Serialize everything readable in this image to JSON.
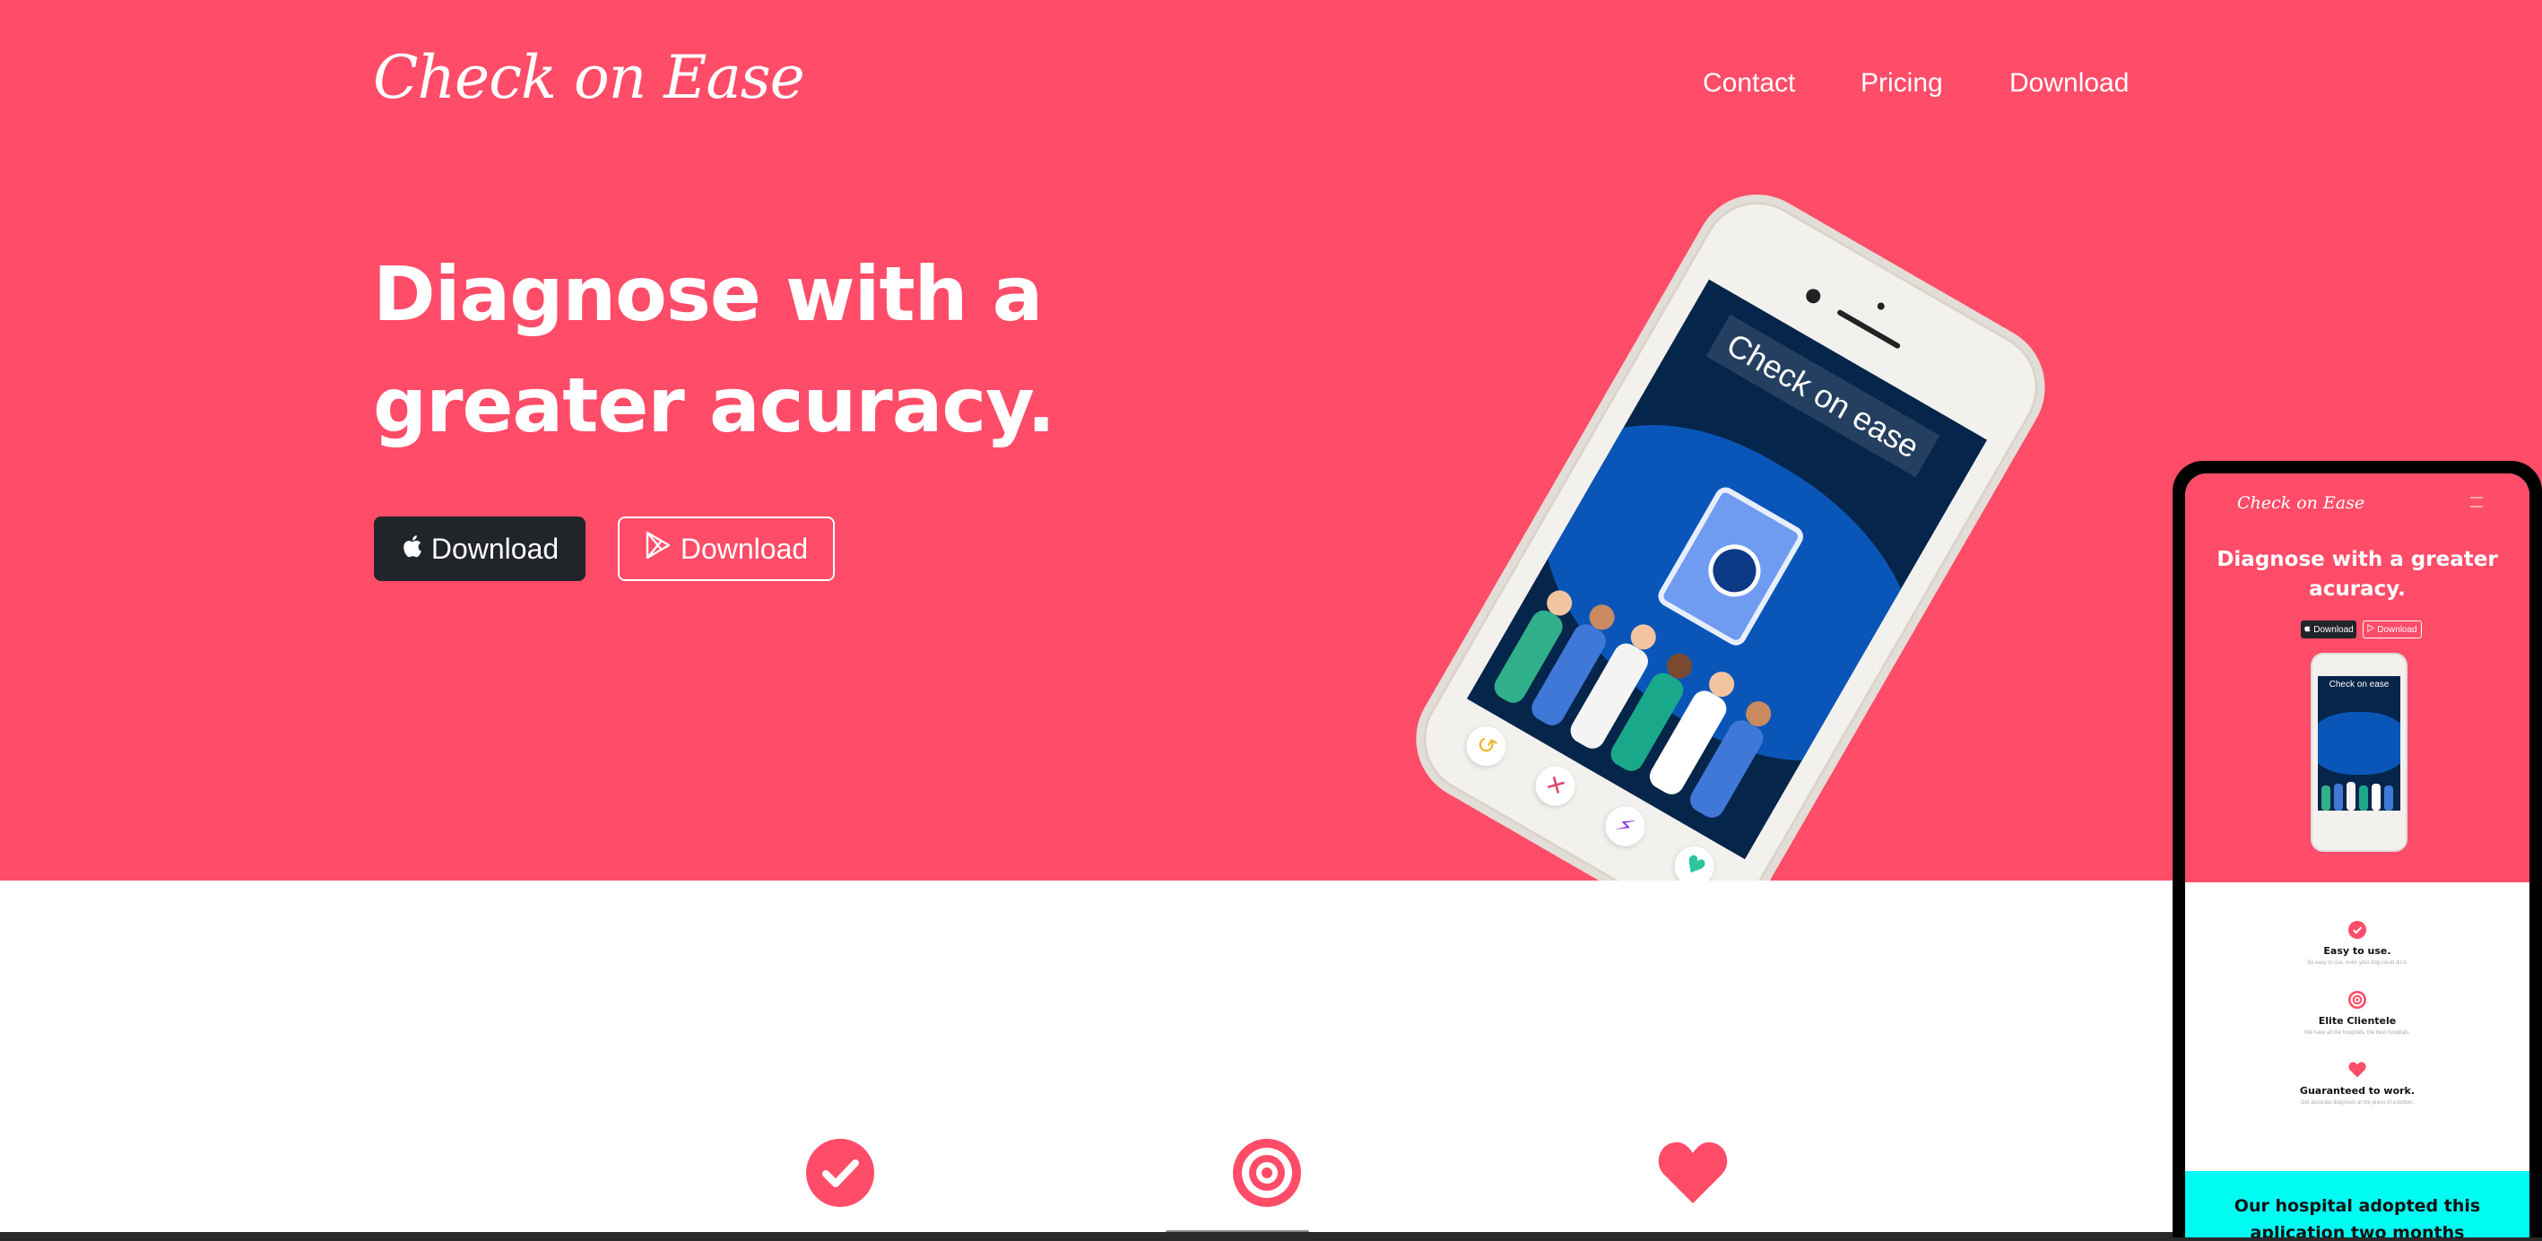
{
  "brand": "Check on Ease",
  "nav": {
    "contact": "Contact",
    "pricing": "Pricing",
    "download": "Download"
  },
  "hero": {
    "headline_line1": "Diagnose with a",
    "headline_line2": "greater acuracy.",
    "buttons": {
      "apple_label": "Download",
      "google_label": "Download"
    },
    "phone_app_title": "Check on ease"
  },
  "features": [
    {
      "icon": "check-circle-icon"
    },
    {
      "icon": "bullseye-icon"
    },
    {
      "icon": "heart-icon"
    }
  ],
  "mobile_preview": {
    "brand": "Check on Ease",
    "headline": "Diagnose with a greater acuracy.",
    "btn_apple": "Download",
    "btn_google": "Download",
    "phone_app_title": "Check on ease",
    "features": [
      {
        "title": "Easy to use.",
        "desc": "So easy to use, even your dog could do it."
      },
      {
        "title": "Elite Clientele",
        "desc": "We have all the hospitals, the best hospitals."
      },
      {
        "title": "Guaranteed to work.",
        "desc": "Get accurate diagnosis at the press of a button."
      }
    ],
    "testimonial": "Our hospital adopted this aplication two months"
  },
  "colors": {
    "primary": "#ff4c68",
    "dark_button": "#212529",
    "testimonial_bg": "#00fbf3",
    "screen_bg": "#06254a"
  }
}
